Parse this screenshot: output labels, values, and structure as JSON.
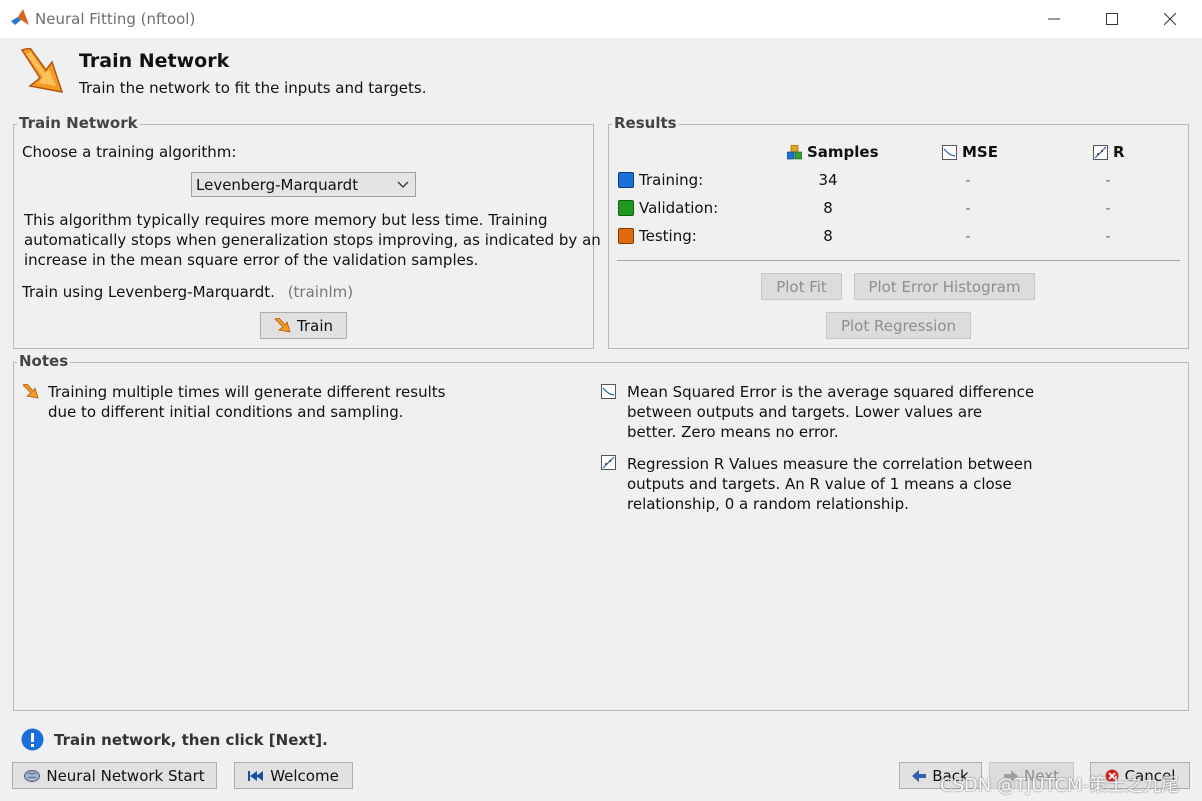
{
  "window": {
    "title": "Neural Fitting (nftool)"
  },
  "header": {
    "title": "Train Network",
    "subtitle": "Train the network to fit the inputs and targets."
  },
  "train_network": {
    "group_label": "Train Network",
    "choose_label": "Choose a training algorithm:",
    "algorithm_selected": "Levenberg-Marquardt",
    "description_lines": [
      "This algorithm typically requires more memory but less time. Training",
      "automatically stops when generalization stops improving, as indicated by an",
      "increase in the mean square error of the validation samples."
    ],
    "train_using": "Train using Levenberg-Marquardt.",
    "train_function": "(trainlm)",
    "train_button": "Train"
  },
  "results": {
    "group_label": "Results",
    "columns": {
      "samples": "Samples",
      "mse": "MSE",
      "r": "R"
    },
    "rows": [
      {
        "label": "Training:",
        "samples": "34",
        "mse": "-",
        "r": "-",
        "color": "#1a6fd8"
      },
      {
        "label": "Validation:",
        "samples": "8",
        "mse": "-",
        "r": "-",
        "color": "#1f9a1f"
      },
      {
        "label": "Testing:",
        "samples": "8",
        "mse": "-",
        "r": "-",
        "color": "#e06a10"
      }
    ],
    "buttons": {
      "plot_fit": "Plot Fit",
      "plot_error_histogram": "Plot Error Histogram",
      "plot_regression": "Plot Regression"
    }
  },
  "notes": {
    "group_label": "Notes",
    "note_training_lines": [
      "Training multiple times will generate different results",
      "due to different initial conditions and sampling."
    ],
    "note_mse_lines": [
      "Mean Squared Error is the average squared difference",
      "between outputs and targets. Lower values are",
      "better. Zero means no error."
    ],
    "note_r_lines": [
      "Regression R Values measure the correlation between",
      "outputs and targets. An R value of 1 means a close",
      "relationship, 0 a random relationship."
    ]
  },
  "status": {
    "text": "Train network, then click [Next]."
  },
  "footer": {
    "nn_start": "Neural Network Start",
    "welcome": "Welcome",
    "back": "Back",
    "next": "Next",
    "cancel": "Cancel"
  },
  "watermark": "CSDN @TJUTCM-策士之九尾",
  "colors": {
    "accent": "#1a6fd8",
    "background": "#f0f0f0"
  }
}
